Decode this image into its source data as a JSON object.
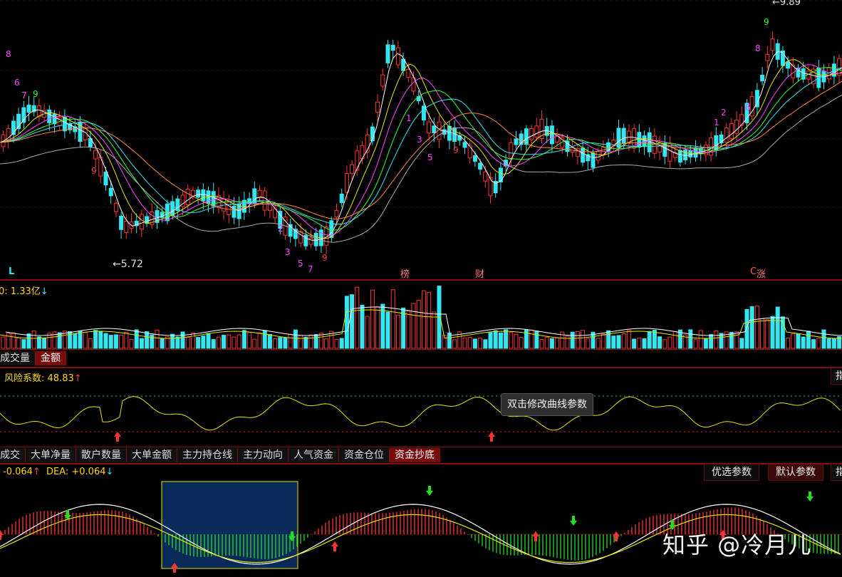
{
  "price_panel": {
    "high_label": "9.89",
    "low_label": "5.72",
    "marker_l": "L",
    "marker_bang": "榜",
    "marker_cai": "财",
    "marker_c": "C",
    "marker_zhang": "涨",
    "up_color": "#ff3333",
    "down_color": "#33e6f0"
  },
  "volume_panel": {
    "readout_prefix": "0: ",
    "readout_value": "1.33亿",
    "readout_arrow": "↓",
    "tabs": [
      "成交量",
      "金额"
    ],
    "active_tab": 1
  },
  "risk_panel": {
    "readout_label": "风险系数: ",
    "readout_value": "48.83",
    "readout_arrow": "↑",
    "tooltip": "双击修改曲线参数",
    "tabs": [
      "成交",
      "大单净量",
      "散户数量",
      "大单金额",
      "主力持仓线",
      "主力动向",
      "人气资金",
      "资金仓位",
      "资金抄底"
    ],
    "active_tab": 8
  },
  "macd_panel": {
    "readout_a": "-0.064",
    "readout_a_arrow": "↑",
    "readout_b_label": "DEA: ",
    "readout_b": "+0.064",
    "readout_b_arrow": "↓",
    "btn_opt": "优选参数",
    "btn_default": "默认参数",
    "btn_extra": "指"
  },
  "watermark": "知乎 @冷月儿",
  "accent_color": "#8a0d0d",
  "line_yellow": "#e6e600"
}
